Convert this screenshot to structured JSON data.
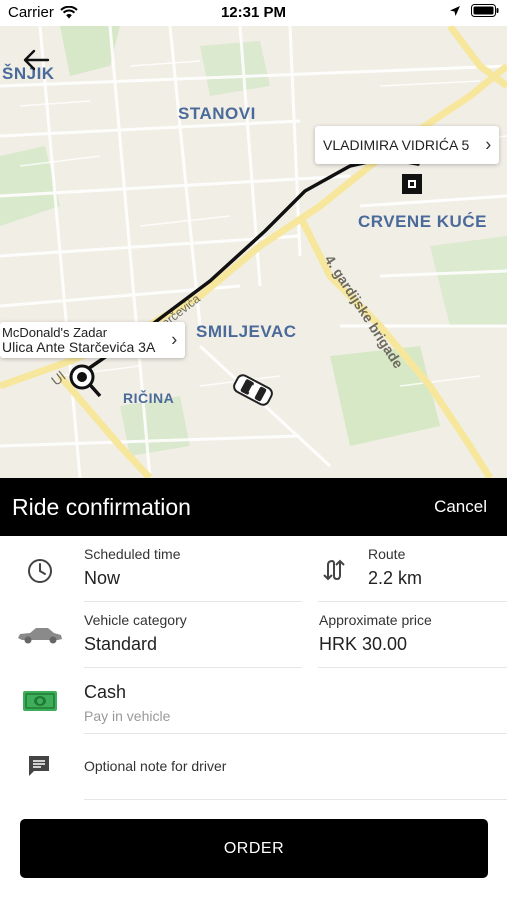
{
  "status_bar": {
    "carrier": "Carrier",
    "time": "12:31 PM"
  },
  "map": {
    "labels": {
      "snjik": "ŠNJIK",
      "stanovi": "STANOVI",
      "crvene_kuce": "CRVENE KUĆE",
      "smiljevac": "SMILJEVAC",
      "ricina": "RIČINA",
      "gardijske": "4. gardijske brigade",
      "starcevica": "Starčevića",
      "ulica": "Ul"
    },
    "destination": {
      "label": "VLADIMIRA VIDRIĆA 5"
    },
    "origin": {
      "name": "McDonald's Zadar",
      "address": "Ulica Ante Starčevića 3A"
    }
  },
  "header": {
    "title": "Ride confirmation",
    "cancel_label": "Cancel"
  },
  "details": {
    "scheduled_time": {
      "label": "Scheduled time",
      "value": "Now",
      "icon": "clock-icon"
    },
    "route": {
      "label": "Route",
      "value": "2.2 km",
      "icon": "route-arrows-icon"
    },
    "vehicle_category": {
      "label": "Vehicle category",
      "value": "Standard",
      "icon": "car-icon"
    },
    "price": {
      "label": "Approximate price",
      "value": "HRK 30.00"
    },
    "payment": {
      "label": "Cash",
      "sublabel": "Pay in vehicle",
      "icon": "cash-icon"
    },
    "note": {
      "label": "Optional note for driver",
      "icon": "message-icon"
    }
  },
  "order_button": {
    "label": "ORDER"
  },
  "colors": {
    "header_bg": "#000000",
    "map_bg": "#f1eee6",
    "label_blue": "#4a6a9a",
    "cash_green": "#3fae5a"
  }
}
